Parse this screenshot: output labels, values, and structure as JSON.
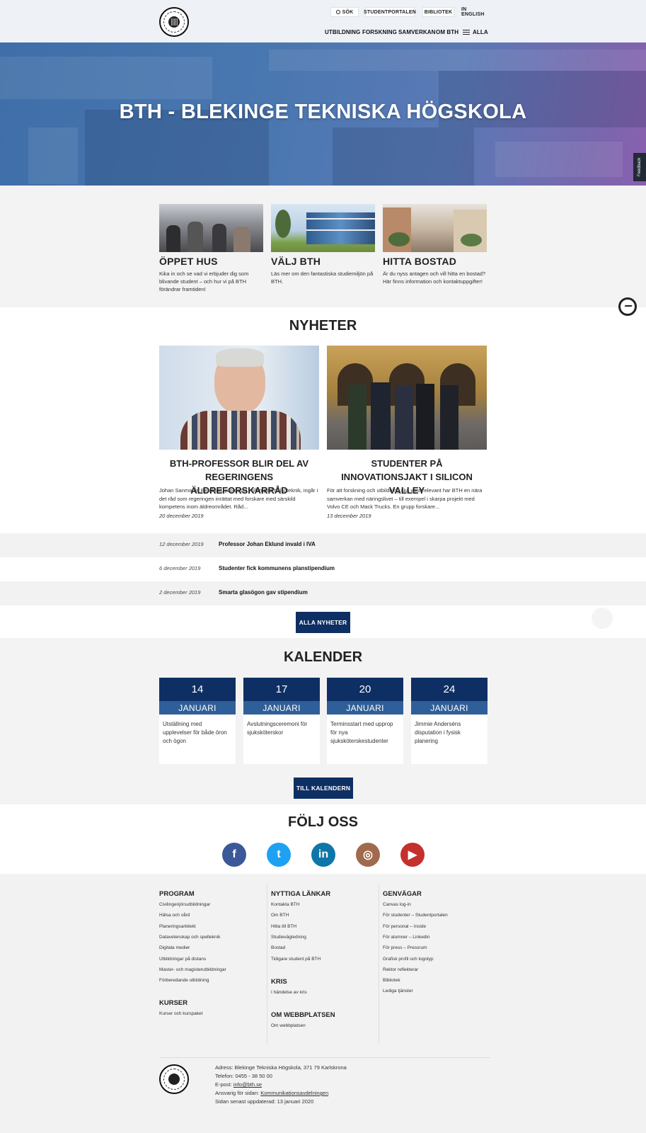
{
  "header": {
    "search_label": "SÖK",
    "student_portal": "STUDENTPORTALEN",
    "library": "BIBLIOTEK",
    "english": "IN ENGLISH",
    "nav": [
      "UTBILDNING",
      "FORSKNING",
      "SAMVERKAN",
      "OM BTH"
    ],
    "menu_label": "ALLA",
    "logo_text": "BLEKINGE TEKNISKA HÖGSKOLA · BTH ·"
  },
  "hero": {
    "title": "BTH - BLEKINGE TEKNISKA HÖGSKOLA"
  },
  "feedback_label": "Feedback",
  "promo": [
    {
      "title": "ÖPPET HUS",
      "text": "Kika in och se vad vi erbjuder dig som blivande student – och hur vi på BTH förändrar framtiden!"
    },
    {
      "title": "VÄLJ BTH",
      "text": "Läs mer om den fantastiska studiemiljön på BTH."
    },
    {
      "title": "HITTA BOSTAD",
      "text": "Är du nyss antagen och vill hitta en bostad? Här finns information och kontaktuppgifter!"
    }
  ],
  "news": {
    "heading": "NYHETER",
    "featured": [
      {
        "title": "BTH-PROFESSOR BLIR DEL AV REGERINGENS ÄLDREFORSKARRÅD",
        "text": "Johan Sanmartin Berglund, professor i tillämpad hälsoteknik, ingår i det råd som regeringen inrättat med forskare med särskild kompetens inom äldreområdet. Råd...",
        "date": "20 december 2019"
      },
      {
        "title": "STUDENTER PÅ INNOVATIONSJAKT I SILICON VALLEY",
        "text": "För att forskning och utbildning ska vara relevant har BTH en nära samverkan med näringslivet – till exempel i skarpa projekt med Volvo CE och Mack Trucks. En grupp forskare...",
        "date": "13 december 2019"
      }
    ],
    "list": [
      {
        "date": "12 december 2019",
        "title": "Professor Johan Eklund invald i IVA"
      },
      {
        "date": "6 december 2019",
        "title": "Studenter fick kommunens planstipendium"
      },
      {
        "date": "2 december 2019",
        "title": "Smarta glasögon gav stipendium"
      }
    ],
    "all_button": "ALLA NYHETER"
  },
  "calendar": {
    "heading": "KALENDER",
    "events": [
      {
        "day": "14",
        "month": "JANUARI",
        "text": "Utställning med upplevelser för både öron och ögon"
      },
      {
        "day": "17",
        "month": "JANUARI",
        "text": "Avslutningsceremoni för sjuksköterskor"
      },
      {
        "day": "20",
        "month": "JANUARI",
        "text": "Terminsstart med upprop för nya sjuksköterskestudenter"
      },
      {
        "day": "24",
        "month": "JANUARI",
        "text": "Jimmie Anderséns disputation i fysisk planering"
      }
    ],
    "button": "TILL KALENDERN"
  },
  "follow": {
    "heading": "FÖLJ OSS",
    "networks": [
      {
        "name": "facebook-icon",
        "glyph": "f",
        "color": "#3b5998"
      },
      {
        "name": "twitter-icon",
        "glyph": "t",
        "color": "#1da1f2"
      },
      {
        "name": "linkedin-icon",
        "glyph": "in",
        "color": "#0e76a8"
      },
      {
        "name": "instagram-icon",
        "glyph": "◎",
        "color": "#a06a4e"
      },
      {
        "name": "youtube-icon",
        "glyph": "▶",
        "color": "#c4302b"
      }
    ]
  },
  "footer": {
    "program": {
      "heading": "PROGRAM",
      "links": [
        "Civilingenjörsutbildningar",
        "Hälsa och vård",
        "Planeringsarkitekt",
        "Datavetenskap och spelteknik",
        "Digitala medier",
        "Utbildningar på distans",
        "Master- och magisterutbildningar",
        "Förberedande utbildning"
      ]
    },
    "kurser": {
      "heading": "KURSER",
      "links": [
        "Kurser och kurspaket"
      ]
    },
    "nyttiga": {
      "heading": "NYTTIGA LÄNKAR",
      "links": [
        "Kontakta BTH",
        "Om BTH",
        "Hitta till BTH",
        "Studievägledning",
        "Bostad",
        "Tidigare student på BTH"
      ]
    },
    "kris": {
      "heading": "KRIS",
      "links": [
        "I händelse av kris"
      ]
    },
    "webb": {
      "heading": "OM WEBBPLATSEN",
      "links": [
        "Om webbplatsen"
      ]
    },
    "genvagar": {
      "heading": "GENVÄGAR",
      "links": [
        "Canvas log-in",
        "För studenter – Studentportalen",
        "För personal – Inside",
        "För alumner – Linkedin",
        "För press – Pressrum",
        "Grafisk profil och logotyp",
        "Rektor reflekterar",
        "Bibliotek",
        "Lediga tjänster"
      ]
    },
    "address": "Adress: Blekinge Tekniska Högskola, 371 79 Karlskrona",
    "phone": "Telefon: 0455 - 38 50 00",
    "email_label": "E-post:",
    "email": "info@bth.se",
    "responsible_label": "Ansvarig för sidan:",
    "responsible": "Kommunikationsavdelningen",
    "updated": "Sidan senast uppdaterad: 13 januari 2020"
  }
}
